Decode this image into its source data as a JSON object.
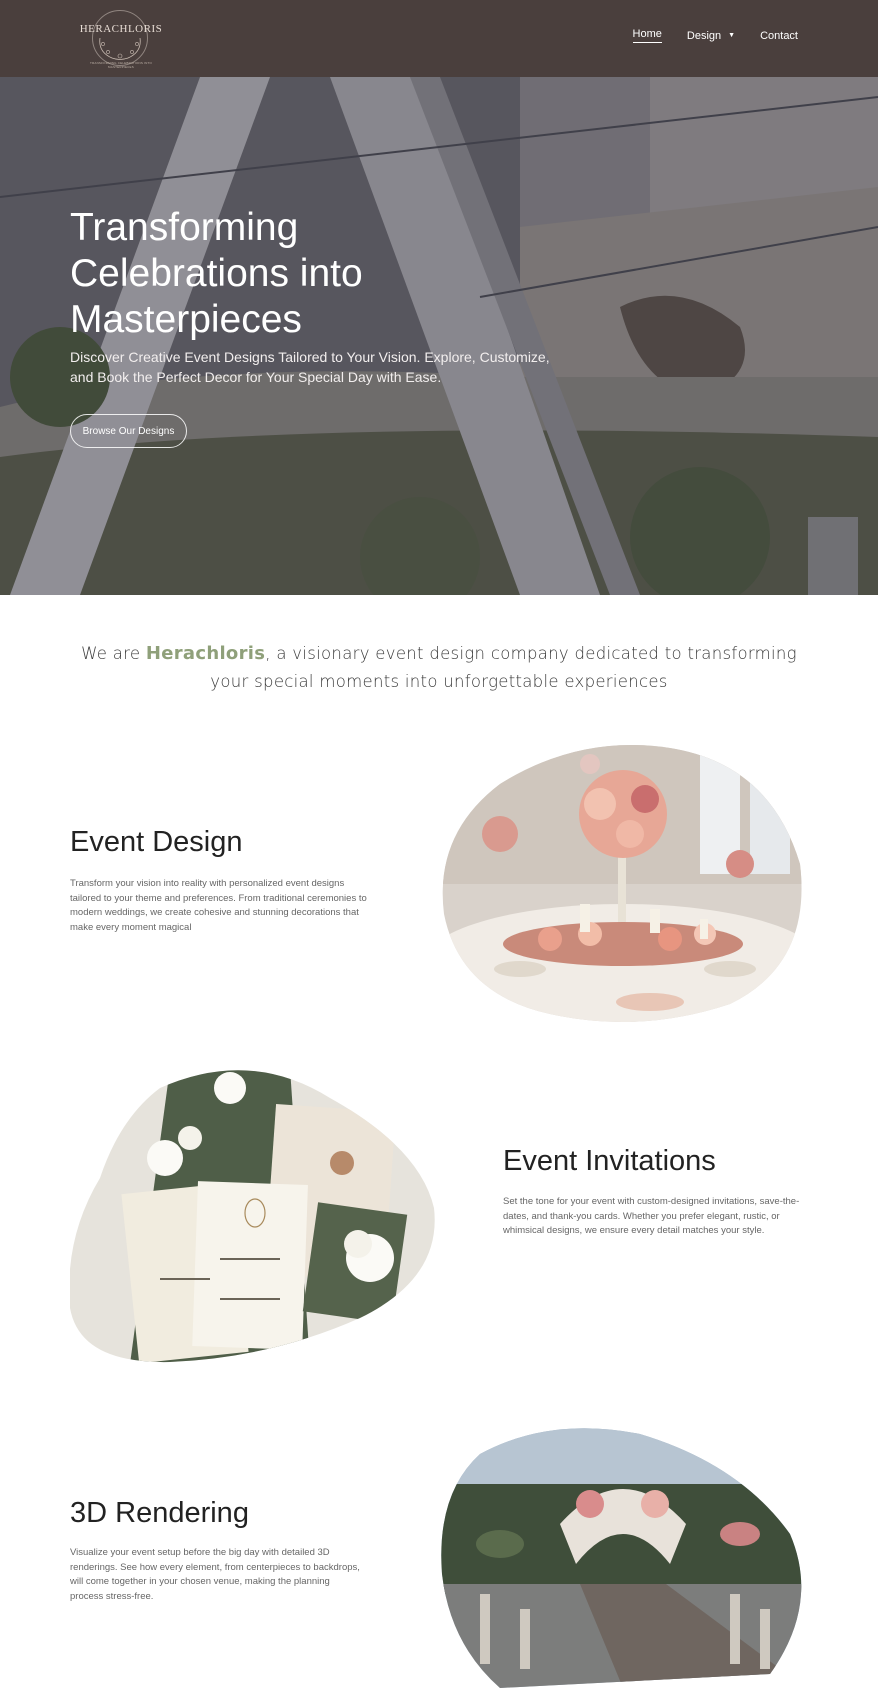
{
  "nav": {
    "logo_text": "HERACHLORIS",
    "logo_tagline": "TRANSFORMING CELEBRATIONS INTO MASTERPIECES",
    "links": [
      {
        "label": "Home",
        "active": true
      },
      {
        "label": "Design",
        "has_dropdown": true
      },
      {
        "label": "Contact"
      }
    ]
  },
  "hero": {
    "title": "Transforming Celebrations into Masterpieces",
    "subtitle": "Discover Creative Event Designs Tailored to Your Vision. Explore, Customize, and Book the Perfect Decor for Your Special Day with Ease.",
    "cta_label": "Browse Our Designs"
  },
  "intro": {
    "prefix": "We are ",
    "brand": "Herachloris",
    "suffix": ", a visionary event design company dedicated to transforming your special moments into unforgettable experiences"
  },
  "sections": [
    {
      "title": "Event Design",
      "text": "Transform your vision into reality with personalized event designs tailored to your theme and preferences. From traditional ceremonies to modern weddings, we create cohesive and stunning decorations that make every moment magical"
    },
    {
      "title": "Event Invitations",
      "text": "Set the tone for your event with custom-designed invitations, save-the-dates, and thank-you cards. Whether you prefer elegant, rustic, or whimsical designs, we ensure every detail matches your style."
    },
    {
      "title": "3D Rendering",
      "text": "Visualize your event setup before the big day with detailed 3D renderings. See how every element, from centerpieces to backdrops, will come together in your chosen venue, making the planning process stress-free."
    }
  ],
  "colors": {
    "nav_bg": "#4a3f3d",
    "brand_accent": "#8fa07a",
    "heading": "#222222",
    "body_text": "#666666"
  }
}
